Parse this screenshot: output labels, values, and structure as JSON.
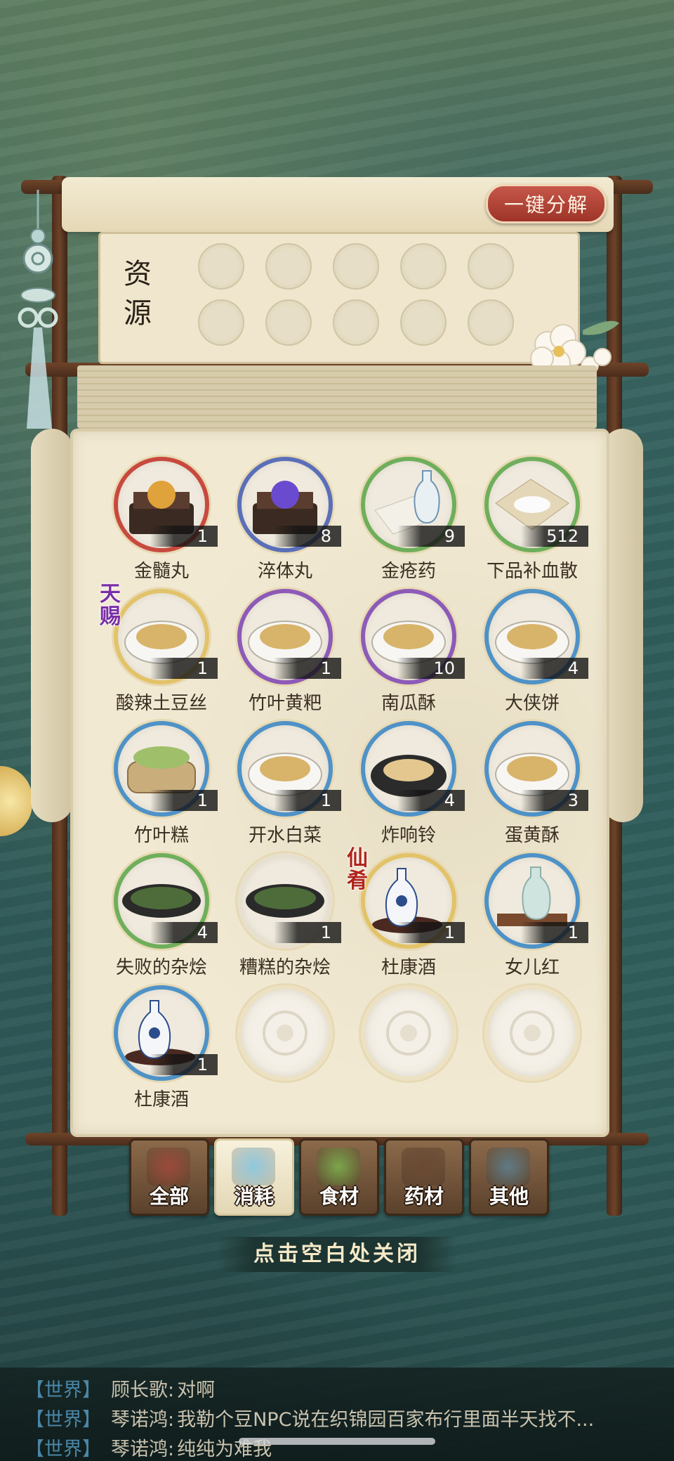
{
  "header": {
    "decompose_button": "一键分解"
  },
  "resources": {
    "title": "资源"
  },
  "items": [
    {
      "name": "金髓丸",
      "count": "1",
      "ring": "#c84a3e",
      "art": "ball-gold"
    },
    {
      "name": "淬体丸",
      "count": "8",
      "ring": "#5a6fb8",
      "art": "ball-purple"
    },
    {
      "name": "金疮药",
      "count": "9",
      "ring": "#6fae5a",
      "art": "powder-vase"
    },
    {
      "name": "下品补血散",
      "count": "512",
      "ring": "#6fae5a",
      "art": "powder"
    },
    {
      "name": "酸辣土豆丝",
      "count": "1",
      "ring": "#e3c36a",
      "art": "plate",
      "tag": "天赐",
      "tag_color": "#7a2fa6"
    },
    {
      "name": "竹叶黄粑",
      "count": "1",
      "ring": "#8d5ab8",
      "art": "plate"
    },
    {
      "name": "南瓜酥",
      "count": "10",
      "ring": "#8d5ab8",
      "art": "plate"
    },
    {
      "name": "大侠饼",
      "count": "4",
      "ring": "#4f92c8",
      "art": "plate"
    },
    {
      "name": "竹叶糕",
      "count": "1",
      "ring": "#4f92c8",
      "art": "steamer"
    },
    {
      "name": "开水白菜",
      "count": "1",
      "ring": "#4f92c8",
      "art": "plate"
    },
    {
      "name": "炸响铃",
      "count": "4",
      "ring": "#4f92c8",
      "art": "plate-dark"
    },
    {
      "name": "蛋黄酥",
      "count": "3",
      "ring": "#4f92c8",
      "art": "plate"
    },
    {
      "name": "失败的杂烩",
      "count": "4",
      "ring": "#6fae5a",
      "art": "pot"
    },
    {
      "name": "糟糕的杂烩",
      "count": "1",
      "ring": "#e7e0cf",
      "art": "pot"
    },
    {
      "name": "杜康酒",
      "count": "1",
      "ring": "#e3c36a",
      "art": "jug",
      "tag": "仙肴",
      "tag_color": "#b0261c"
    },
    {
      "name": "女儿红",
      "count": "1",
      "ring": "#4f92c8",
      "art": "bottle"
    },
    {
      "name": "杜康酒",
      "count": "1",
      "ring": "#4f92c8",
      "art": "jug"
    },
    {
      "name": "",
      "count": "",
      "empty": true
    },
    {
      "name": "",
      "count": "",
      "empty": true
    },
    {
      "name": "",
      "count": "",
      "empty": true
    }
  ],
  "tabs": [
    {
      "label": "全部",
      "active": false,
      "art_color": "#9c4a3a"
    },
    {
      "label": "消耗",
      "active": true,
      "art_color": "#8fc8de"
    },
    {
      "label": "食材",
      "active": false,
      "art_color": "#7aa64a"
    },
    {
      "label": "药材",
      "active": false,
      "art_color": "#6b4a33"
    },
    {
      "label": "其他",
      "active": false,
      "art_color": "#5f7a84"
    }
  ],
  "close_hint": "点击空白处关闭",
  "chat": [
    {
      "channel": "【世界】",
      "speaker": "顾长歌:",
      "message": "对啊"
    },
    {
      "channel": "【世界】",
      "speaker": "琴诺鸿:",
      "message": "我勒个豆NPC说在织锦园百家布行里面半天找不..."
    },
    {
      "channel": "【世界】",
      "speaker": "琴诺鸿:",
      "message": "纯纯为难我"
    }
  ]
}
